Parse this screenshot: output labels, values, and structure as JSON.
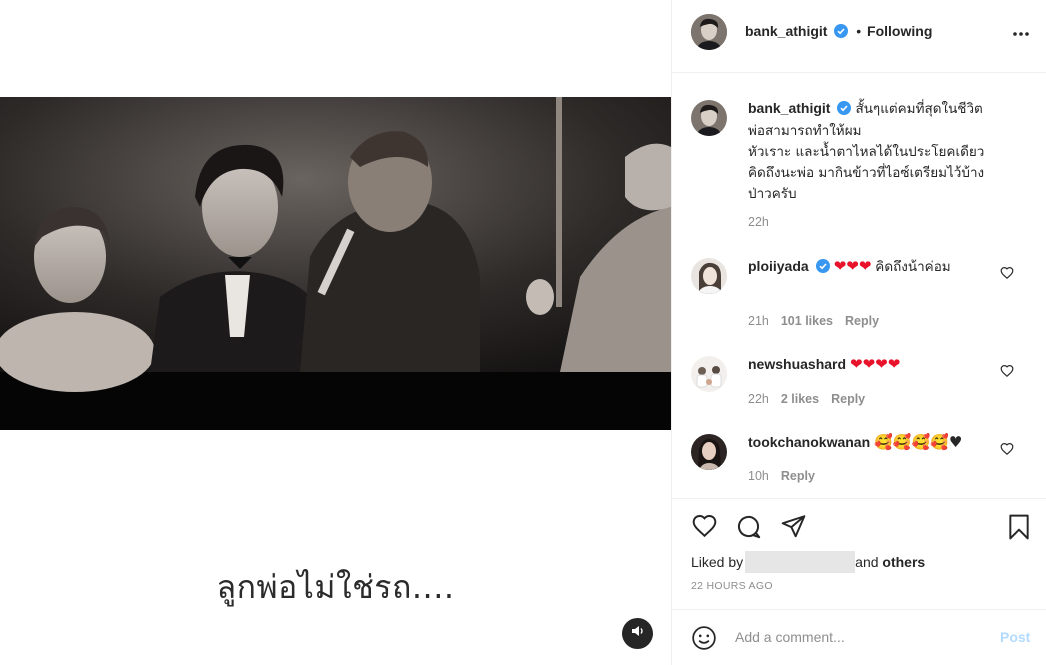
{
  "post": {
    "owner": "bank_athigit",
    "follow_separator": "•",
    "follow_status": "Following",
    "video_caption": "ลูกพ่อไม่ใช่รถ....",
    "caption_lines": [
      "สั้นๆแต่คมที่สุดในชีวิต",
      "พ่อสามารถทำให้ผม",
      "หัวเราะ และน้ำตาไหลได้ในประโยคเดียว",
      "คิดถึงนะพ่อ มากินข้าวที่ไอซ์เตรียมไว้บ้าง",
      "ป่าวครับ"
    ],
    "caption_time": "22h",
    "liked_by_label": "Liked by",
    "liked_and": "and",
    "liked_others": "others",
    "time_ago": "22 HOURS AGO"
  },
  "comments": [
    {
      "user": "ploiiyada",
      "verified": true,
      "text_hearts": "❤❤❤",
      "text": "คิดถึงน้าค่อม",
      "time": "21h",
      "likes": "101 likes",
      "reply": "Reply"
    },
    {
      "user": "newshuashard",
      "verified": false,
      "text_hearts": "❤❤❤❤",
      "text": "",
      "time": "22h",
      "likes": "2 likes",
      "reply": "Reply"
    },
    {
      "user": "tookchanokwanan",
      "verified": false,
      "text_hearts": "🥰🥰🥰🥰♥",
      "text": "",
      "time": "10h",
      "likes": "",
      "reply": "Reply"
    }
  ],
  "add_comment": {
    "placeholder": "Add a comment...",
    "post_label": "Post"
  },
  "colors": {
    "accent_blue": "#3897f0",
    "post_disabled": "#b3dbff",
    "heart_red": "#e8132b",
    "muted_text": "#8e8e8e"
  },
  "icons": [
    "verified-badge-icon",
    "more-options-icon",
    "heart-icon",
    "comment-icon",
    "share-icon",
    "bookmark-icon",
    "emoji-icon",
    "speaker-icon"
  ]
}
